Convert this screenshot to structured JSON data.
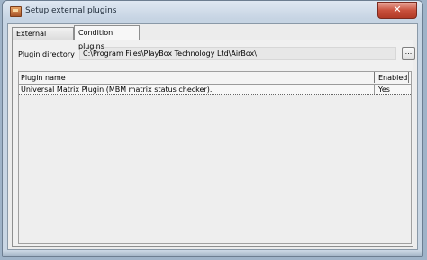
{
  "window": {
    "title": "Setup external plugins",
    "close_glyph": "✕"
  },
  "tabs": [
    {
      "label": "External plugins",
      "active": false
    },
    {
      "label": "Condition plugins",
      "active": true
    }
  ],
  "plugin_directory": {
    "label": "Plugin directory",
    "value": "C:\\Program Files\\PlayBox Technology Ltd\\AirBox\\",
    "browse_label": "..."
  },
  "table": {
    "columns": [
      "Plugin name",
      "Enabled"
    ],
    "rows": [
      {
        "name": "Universal Matrix Plugin (MBM matrix status checker).",
        "enabled": "Yes"
      }
    ]
  },
  "icons": {
    "app": "plugin-app-icon",
    "close": "close-icon"
  }
}
